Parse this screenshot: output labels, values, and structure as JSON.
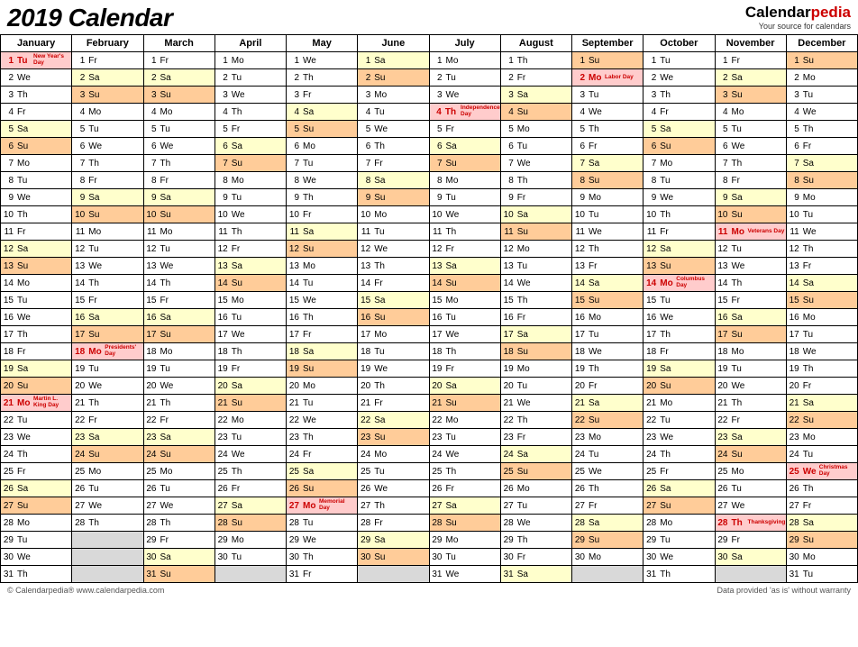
{
  "title": "2019 Calendar",
  "brand": {
    "prefix": "Calendar",
    "suffix": "pedia",
    "tagline": "Your source for calendars"
  },
  "footer": {
    "left": "© Calendarpedia®   www.calendarpedia.com",
    "right": "Data provided 'as is' without warranty"
  },
  "months": [
    "January",
    "February",
    "March",
    "April",
    "May",
    "June",
    "July",
    "August",
    "September",
    "October",
    "November",
    "December"
  ],
  "start_dow": [
    1,
    4,
    4,
    0,
    2,
    5,
    0,
    3,
    6,
    1,
    4,
    6
  ],
  "days_in_month": [
    31,
    28,
    31,
    30,
    31,
    30,
    31,
    31,
    30,
    31,
    30,
    31
  ],
  "dow_names": [
    "Mo",
    "Tu",
    "We",
    "Th",
    "Fr",
    "Sa",
    "Su"
  ],
  "holidays": {
    "0": {
      "1": "New Year's Day",
      "21": "Martin L. King Day"
    },
    "1": {
      "18": "Presidents' Day"
    },
    "4": {
      "27": "Memorial Day"
    },
    "6": {
      "4": "Independence Day"
    },
    "8": {
      "2": "Labor Day"
    },
    "9": {
      "14": "Columbus Day"
    },
    "10": {
      "11": "Veterans Day",
      "28": "Thanksgiving"
    },
    "11": {
      "25": "Christmas Day"
    }
  }
}
